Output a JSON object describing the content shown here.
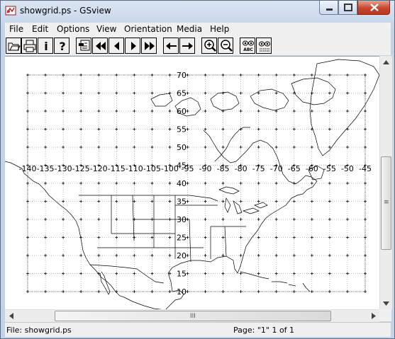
{
  "window": {
    "title": "showgrid.ps - GSview",
    "controls": [
      "minimize",
      "maximize",
      "close"
    ]
  },
  "menu": [
    "File",
    "Edit",
    "Options",
    "View",
    "Orientation",
    "Media",
    "Help"
  ],
  "toolbar": {
    "buttons": [
      {
        "name": "open-file-icon"
      },
      {
        "name": "print-icon"
      },
      {
        "name": "info-icon",
        "glyph": "i"
      },
      {
        "name": "help-icon",
        "glyph": "?"
      },
      {
        "name": "goto-page-icon"
      },
      {
        "name": "first-page-icon"
      },
      {
        "name": "prev-page-icon"
      },
      {
        "name": "next-page-icon"
      },
      {
        "name": "last-page-icon"
      },
      {
        "name": "back-arrow-icon"
      },
      {
        "name": "forward-arrow-icon"
      },
      {
        "name": "zoom-in-icon"
      },
      {
        "name": "zoom-out-icon"
      },
      {
        "name": "text-extract-icon",
        "glyph": "ABC"
      },
      {
        "name": "find-icon"
      }
    ]
  },
  "map": {
    "lon_labels": [
      "-140",
      "-135",
      "-130",
      "-125",
      "-120",
      "-115",
      "-110",
      "-105",
      "-100",
      "-95",
      "-90",
      "-85",
      "-80",
      "-75",
      "-70",
      "-65",
      "-60",
      "-55",
      "-50",
      "-45"
    ],
    "lat_labels": [
      "70",
      "65",
      "60",
      "55",
      "50",
      "45",
      "40",
      "35",
      "30",
      "25",
      "20",
      "15",
      "10"
    ],
    "lon_range": [
      -140,
      -45
    ],
    "lat_range": [
      10,
      70
    ],
    "grid_step_degrees": 5,
    "line_color": "#000000"
  },
  "scrollbars": {
    "horizontal_grip": "III",
    "vertical_grip": "≡"
  },
  "status": {
    "file": "File: showgrid.ps",
    "page": "Page: \"1\"  1 of 1"
  }
}
